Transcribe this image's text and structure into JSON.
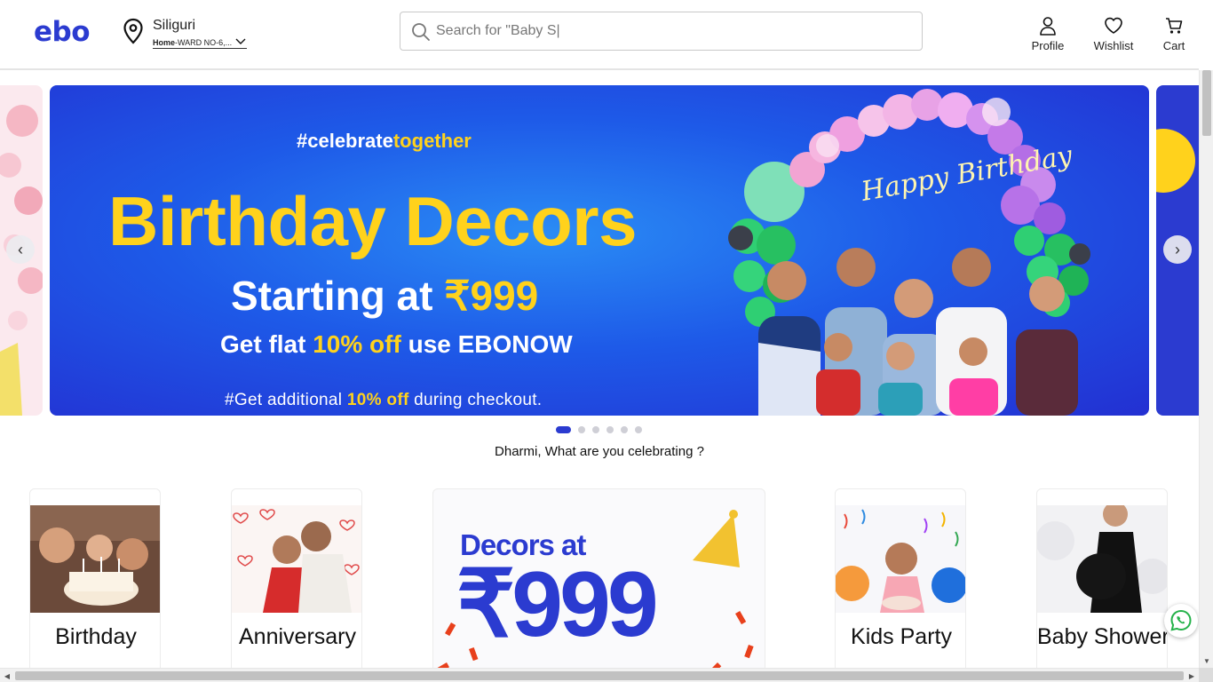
{
  "header": {
    "logo": "ebo",
    "location_city": "Siliguri",
    "location_label": "Home",
    "location_address": "-WARD NO-6,...",
    "search_placeholder": "Search for \"Baby S|",
    "nav": [
      {
        "label": "Profile",
        "icon": "user-icon"
      },
      {
        "label": "Wishlist",
        "icon": "heart-icon"
      },
      {
        "label": "Cart",
        "icon": "cart-icon"
      }
    ]
  },
  "banner": {
    "hashtag_white": "#celebrate",
    "hashtag_yellow": "together",
    "title": "Birthday Decors",
    "price_prefix": "Starting at ",
    "price": "₹999",
    "offer_pre": "Get flat ",
    "offer_highlight": "10% off",
    "offer_post": " use EBONOW",
    "note_pre": "#Get additional ",
    "note_highlight": "10% off",
    "note_post": " during checkout.",
    "art_text": "Happy Birthday",
    "colors": {
      "background": "#2330d2",
      "accent": "#ffd21c"
    }
  },
  "carousel": {
    "prev_icon": "chevron-left-icon",
    "next_icon": "chevron-right-icon",
    "slide_count": 6,
    "active_index": 0
  },
  "greeting": "Dharmi, What are you celebrating ?",
  "categories": [
    {
      "label": "Birthday"
    },
    {
      "label": "Anniversary"
    },
    {
      "label": "Kids Party"
    },
    {
      "label": "Baby Shower"
    }
  ],
  "promo": {
    "line1": "Decors at",
    "line2": "₹999"
  },
  "whatsapp_icon": "whatsapp-icon",
  "theme": {
    "brand": "#2b3bd0"
  }
}
